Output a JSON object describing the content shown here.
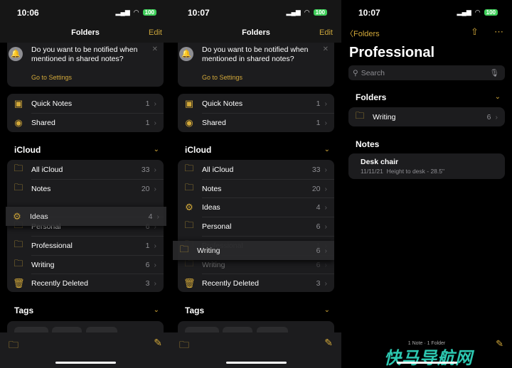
{
  "accent": "#d3a93a",
  "panels": [
    {
      "time": "10:06",
      "battery": "100",
      "nav_title": "Folders",
      "edit": "Edit",
      "banner": {
        "text": "Do you want to be notified when mentioned in shared notes?",
        "link": "Go to Settings"
      },
      "top_items": [
        {
          "icon": "quick-notes-icon",
          "label": "Quick Notes",
          "count": "1"
        },
        {
          "icon": "shared-icon",
          "label": "Shared",
          "count": "1"
        }
      ],
      "icloud": "iCloud",
      "tags": "Tags",
      "items": [
        {
          "icon": "folder-icon",
          "label": "All iCloud",
          "count": "33"
        },
        {
          "icon": "folder-icon",
          "label": "Notes",
          "count": "20"
        },
        {
          "icon": "folder-icon",
          "label": "Personal",
          "count": "6"
        },
        {
          "icon": "folder-icon",
          "label": "Professional",
          "count": "1"
        },
        {
          "icon": "folder-icon",
          "label": "Writing",
          "count": "6"
        },
        {
          "icon": "trash-icon",
          "label": "Recently Deleted",
          "count": "3"
        }
      ],
      "dragged": {
        "icon": "gear-icon",
        "label": "Ideas",
        "count": "4"
      }
    },
    {
      "time": "10:07",
      "battery": "100",
      "nav_title": "Folders",
      "edit": "Edit",
      "banner": {
        "text": "Do you want to be notified when mentioned in shared notes?",
        "link": "Go to Settings"
      },
      "top_items": [
        {
          "icon": "quick-notes-icon",
          "label": "Quick Notes",
          "count": "1"
        },
        {
          "icon": "shared-icon",
          "label": "Shared",
          "count": "1"
        }
      ],
      "icloud": "iCloud",
      "tags": "Tags",
      "items": [
        {
          "icon": "folder-icon",
          "label": "All iCloud",
          "count": "33"
        },
        {
          "icon": "folder-icon",
          "label": "Notes",
          "count": "20"
        },
        {
          "icon": "gear-icon",
          "label": "Ideas",
          "count": "4"
        },
        {
          "icon": "folder-icon",
          "label": "Personal",
          "count": "6"
        },
        {
          "icon": "folder-icon",
          "label": "Professional",
          "count": "1",
          "faded": true
        },
        {
          "icon": "folder-icon",
          "label": "Writing",
          "count": "6",
          "faded": true
        },
        {
          "icon": "trash-icon",
          "label": "Recently Deleted",
          "count": "3"
        }
      ],
      "dragged": {
        "icon": "folder-icon",
        "label": "Writing",
        "count": "6"
      }
    }
  ],
  "detail": {
    "time": "10:07",
    "battery": "100",
    "back": "Folders",
    "title": "Professional",
    "search_placeholder": "Search",
    "folders_header": "Folders",
    "folder": {
      "label": "Writing",
      "count": "6"
    },
    "notes_header": "Notes",
    "note": {
      "title": "Desk chair",
      "date": "11/11/21",
      "preview": "Height to desk - 28.5\""
    },
    "footer": "1 Note · 1 Folder",
    "watermark": "快马导航网"
  }
}
